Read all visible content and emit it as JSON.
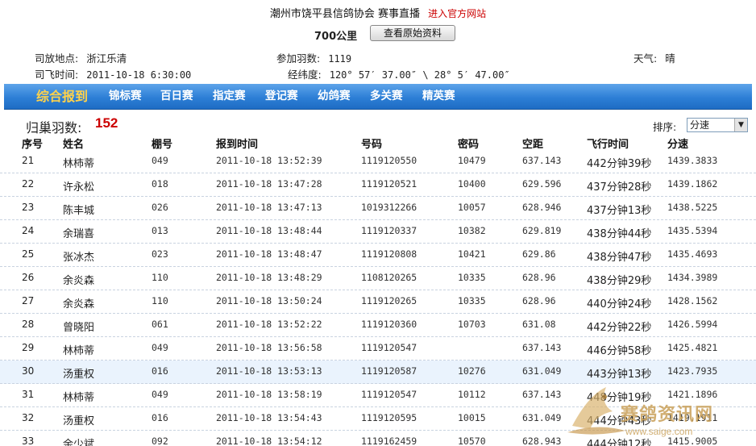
{
  "header": {
    "org": "潮州市饶平县信鸽协会",
    "subtitle": "赛事直播",
    "official_link": "进入官方网站",
    "distance": "700公里",
    "original_button": "查看原始资料"
  },
  "race_info": {
    "release_place_label": "司放地点:",
    "release_place": "浙江乐清",
    "entries_label": "参加羽数:",
    "entries": "1119",
    "weather_label": "天气:",
    "weather": "晴",
    "release_time_label": "司飞时间:",
    "release_time": "2011-10-18 6:30:00",
    "coords_label": "经纬度:",
    "coords": "120° 57′ 37.00″ \\ 28° 5′ 47.00″"
  },
  "nav": {
    "items": [
      {
        "label": "综合报到",
        "active": true
      },
      {
        "label": "锦标赛",
        "active": false
      },
      {
        "label": "百日赛",
        "active": false
      },
      {
        "label": "指定赛",
        "active": false
      },
      {
        "label": "登记赛",
        "active": false
      },
      {
        "label": "幼鸽赛",
        "active": false
      },
      {
        "label": "多关赛",
        "active": false
      },
      {
        "label": "精英赛",
        "active": false
      }
    ]
  },
  "summary": {
    "returned_label": "归巢羽数:",
    "returned_count": "152",
    "sort_label": "排序:",
    "sort_value": "分速"
  },
  "table": {
    "headers": [
      "序号",
      "姓名",
      "棚号",
      "报到时间",
      "号码",
      "密码",
      "空距",
      "飞行时间",
      "分速"
    ],
    "rows": [
      [
        "21",
        "林柿蒂",
        "049",
        "2011-10-18 13:52:39",
        "1119120550",
        "10479",
        "637.143",
        "442分钟39秒",
        "1439.3833"
      ],
      [
        "22",
        "许永松",
        "018",
        "2011-10-18 13:47:28",
        "1119120521",
        "10400",
        "629.596",
        "437分钟28秒",
        "1439.1862"
      ],
      [
        "23",
        "陈丰城",
        "026",
        "2011-10-18 13:47:13",
        "1019312266",
        "10057",
        "628.946",
        "437分钟13秒",
        "1438.5225"
      ],
      [
        "24",
        "余瑞喜",
        "013",
        "2011-10-18 13:48:44",
        "1119120337",
        "10382",
        "629.819",
        "438分钟44秒",
        "1435.5394"
      ],
      [
        "25",
        "张冰杰",
        "023",
        "2011-10-18 13:48:47",
        "1119120808",
        "10421",
        "629.86",
        "438分钟47秒",
        "1435.4693"
      ],
      [
        "26",
        "余炎森",
        "110",
        "2011-10-18 13:48:29",
        "1108120265",
        "10335",
        "628.96",
        "438分钟29秒",
        "1434.3989"
      ],
      [
        "27",
        "余炎森",
        "110",
        "2011-10-18 13:50:24",
        "1119120265",
        "10335",
        "628.96",
        "440分钟24秒",
        "1428.1562"
      ],
      [
        "28",
        "曾晓阳",
        "061",
        "2011-10-18 13:52:22",
        "1119120360",
        "10703",
        "631.08",
        "442分钟22秒",
        "1426.5994"
      ],
      [
        "29",
        "林柿蒂",
        "049",
        "2011-10-18 13:56:58",
        "1119120547",
        "",
        "637.143",
        "446分钟58秒",
        "1425.4821"
      ],
      [
        "30",
        "汤重权",
        "016",
        "2011-10-18 13:53:13",
        "1119120587",
        "10276",
        "631.049",
        "443分钟13秒",
        "1423.7935"
      ],
      [
        "31",
        "林柿蒂",
        "049",
        "2011-10-18 13:58:19",
        "1119120547",
        "10112",
        "637.143",
        "448分钟19秒",
        "1421.1896"
      ],
      [
        "32",
        "汤重权",
        "016",
        "2011-10-18 13:54:43",
        "1119120595",
        "10015",
        "631.049",
        "444分钟43秒",
        "1419.1911"
      ],
      [
        "33",
        "余少斌",
        "092",
        "2011-10-18 13:54:12",
        "1119162459",
        "10570",
        "628.943",
        "444分钟12秒",
        "1415.9005"
      ]
    ],
    "highlighted_row": 9
  },
  "watermark": {
    "text": "赛鸽资讯网",
    "url": "www.saige.com"
  },
  "colors": {
    "nav_blue": "#2d7fd6",
    "active_nav": "#ffd24a",
    "count_red": "#cc0000",
    "highlight_row": "#eaf3fd"
  }
}
